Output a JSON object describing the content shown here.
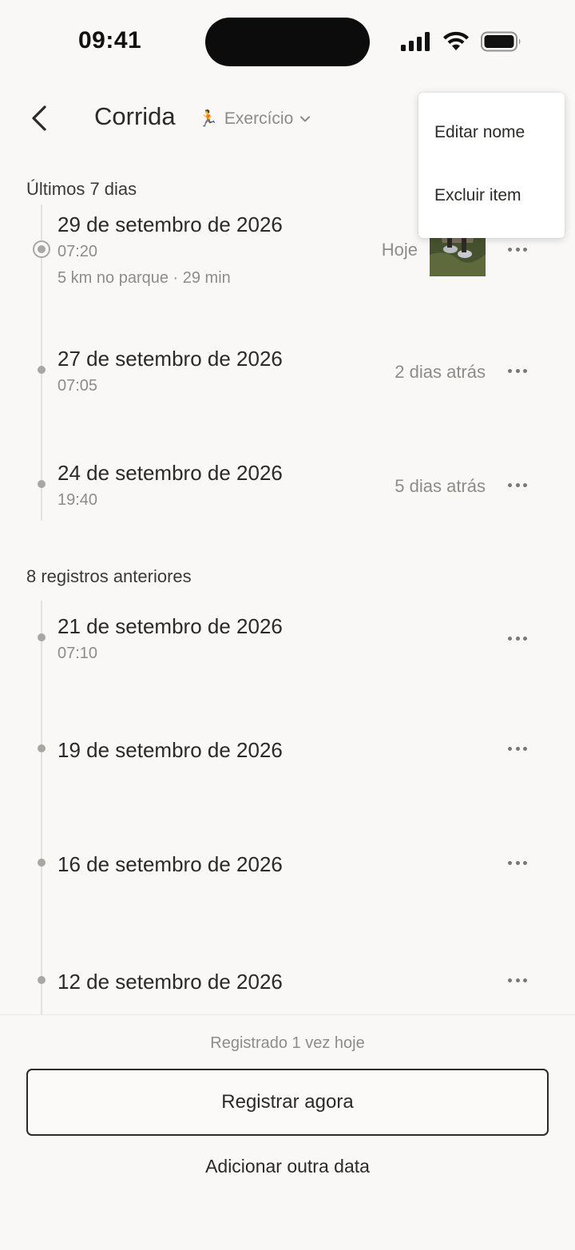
{
  "status_bar": {
    "time": "09:41"
  },
  "header": {
    "title": "Corrida",
    "category_label": "Exercício",
    "category_icon": "runner-icon"
  },
  "sections": {
    "recent_label": "Últimos 7 dias",
    "older_label": "8 registros anteriores"
  },
  "entries_recent": [
    {
      "date": "29 de setembro de 2026",
      "time": "07:20",
      "note": "5 km no parque · 29 min",
      "relative": "Hoje",
      "has_photo": true
    },
    {
      "date": "27 de setembro de 2026",
      "time": "07:05",
      "relative": "2 dias atrás"
    },
    {
      "date": "24 de setembro de 2026",
      "time": "19:40",
      "relative": "5 dias atrás"
    }
  ],
  "entries_older": [
    {
      "date": "21 de setembro de 2026",
      "time": "07:10"
    },
    {
      "date": "19 de setembro de 2026"
    },
    {
      "date": "16 de setembro de 2026"
    },
    {
      "date": "12 de setembro de 2026"
    }
  ],
  "context_menu": {
    "items": [
      "Editar nome",
      "Excluir item"
    ]
  },
  "footer": {
    "status_text": "Registrado 1 vez hoje",
    "primary_label": "Registrar agora",
    "secondary_label": "Adicionar outra data"
  }
}
